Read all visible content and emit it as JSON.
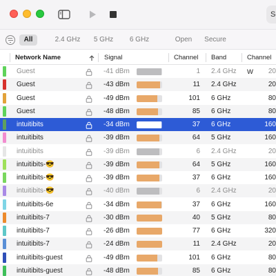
{
  "toolbar": {
    "search_label": "Sc"
  },
  "filters": [
    {
      "label": "All",
      "active": true
    },
    {
      "label": "2.4 GHz",
      "active": false
    },
    {
      "label": "5 GHz",
      "active": false
    },
    {
      "label": "6 GHz",
      "active": false
    },
    {
      "label": "Open",
      "active": false
    },
    {
      "label": "Secure",
      "active": false
    }
  ],
  "columns": {
    "name": "Network Name",
    "signal": "Signal",
    "channel": "Channel",
    "band": "Band",
    "channel_width": "Channel W"
  },
  "colors": {
    "selection": "#2d5bd6",
    "signal_bar": "#e8a869",
    "signal_bar_dim": "#bdbdbf",
    "signal_bar_selected": "#ffffff"
  },
  "rows": [
    {
      "name": "Guest",
      "signal": "-41 dBm",
      "level": 0.97,
      "channel": "1",
      "band": "2.4 GHz",
      "width": "20",
      "color": "#5fd35a",
      "dim": true,
      "selected": false
    },
    {
      "name": "Guest",
      "signal": "-43 dBm",
      "level": 0.93,
      "channel": "11",
      "band": "2.4 GHz",
      "width": "20",
      "color": "#d7322d",
      "dim": false,
      "selected": false
    },
    {
      "name": "Guest",
      "signal": "-49 dBm",
      "level": 0.8,
      "channel": "101",
      "band": "6 GHz",
      "width": "80",
      "color": "#e2a23a",
      "dim": false,
      "selected": false
    },
    {
      "name": "Guest",
      "signal": "-48 dBm",
      "level": 0.83,
      "channel": "85",
      "band": "6 GHz",
      "width": "80",
      "color": "#5fd35a",
      "dim": false,
      "selected": false
    },
    {
      "name": "intuitibits",
      "signal": "-34 dBm",
      "level": 0.98,
      "channel": "37",
      "band": "6 GHz",
      "width": "160",
      "color": "#5fa05f",
      "dim": false,
      "selected": true
    },
    {
      "name": "intuitibits",
      "signal": "-39 dBm",
      "level": 0.9,
      "channel": "64",
      "band": "5 GHz",
      "width": "160",
      "color": "#f28ccf",
      "dim": false,
      "selected": false
    },
    {
      "name": "intuitibits",
      "signal": "-39 dBm",
      "level": 0.9,
      "channel": "6",
      "band": "2.4 GHz",
      "width": "20",
      "color": "#e6e6e6",
      "dim": true,
      "selected": false
    },
    {
      "name": "intuitibits-😎",
      "signal": "-39 dBm",
      "level": 0.9,
      "channel": "64",
      "band": "5 GHz",
      "width": "160",
      "color": "#9ee05a",
      "dim": false,
      "selected": false
    },
    {
      "name": "intuitibits-😎",
      "signal": "-39 dBm",
      "level": 0.9,
      "channel": "37",
      "band": "6 GHz",
      "width": "160",
      "color": "#7ad75e",
      "dim": false,
      "selected": false
    },
    {
      "name": "intuitibits-😎",
      "signal": "-40 dBm",
      "level": 0.88,
      "channel": "6",
      "band": "2.4 GHz",
      "width": "20",
      "color": "#a98ae6",
      "dim": true,
      "selected": false
    },
    {
      "name": "intuitibits-6e",
      "signal": "-34 dBm",
      "level": 0.98,
      "channel": "37",
      "band": "6 GHz",
      "width": "160",
      "color": "#7fd5e6",
      "dim": false,
      "selected": false
    },
    {
      "name": "intuitibits-7",
      "signal": "-30 dBm",
      "level": 1.0,
      "channel": "40",
      "band": "5 GHz",
      "width": "80",
      "color": "#ec8a2c",
      "dim": false,
      "selected": false
    },
    {
      "name": "intuitibits-7",
      "signal": "-26 dBm",
      "level": 1.0,
      "channel": "77",
      "band": "6 GHz",
      "width": "320",
      "color": "#5fc8c8",
      "dim": false,
      "selected": false
    },
    {
      "name": "intuitibits-7",
      "signal": "-24 dBm",
      "level": 1.0,
      "channel": "11",
      "band": "2.4 GHz",
      "width": "20",
      "color": "#5a8fd6",
      "dim": false,
      "selected": false
    },
    {
      "name": "intuitibits-guest",
      "signal": "-49 dBm",
      "level": 0.8,
      "channel": "101",
      "band": "6 GHz",
      "width": "80",
      "color": "#2f4fb8",
      "dim": false,
      "selected": false
    },
    {
      "name": "intuitibits-guest",
      "signal": "-48 dBm",
      "level": 0.83,
      "channel": "85",
      "band": "6 GHz",
      "width": "80",
      "color": "#3fbf5a",
      "dim": false,
      "selected": false
    }
  ]
}
